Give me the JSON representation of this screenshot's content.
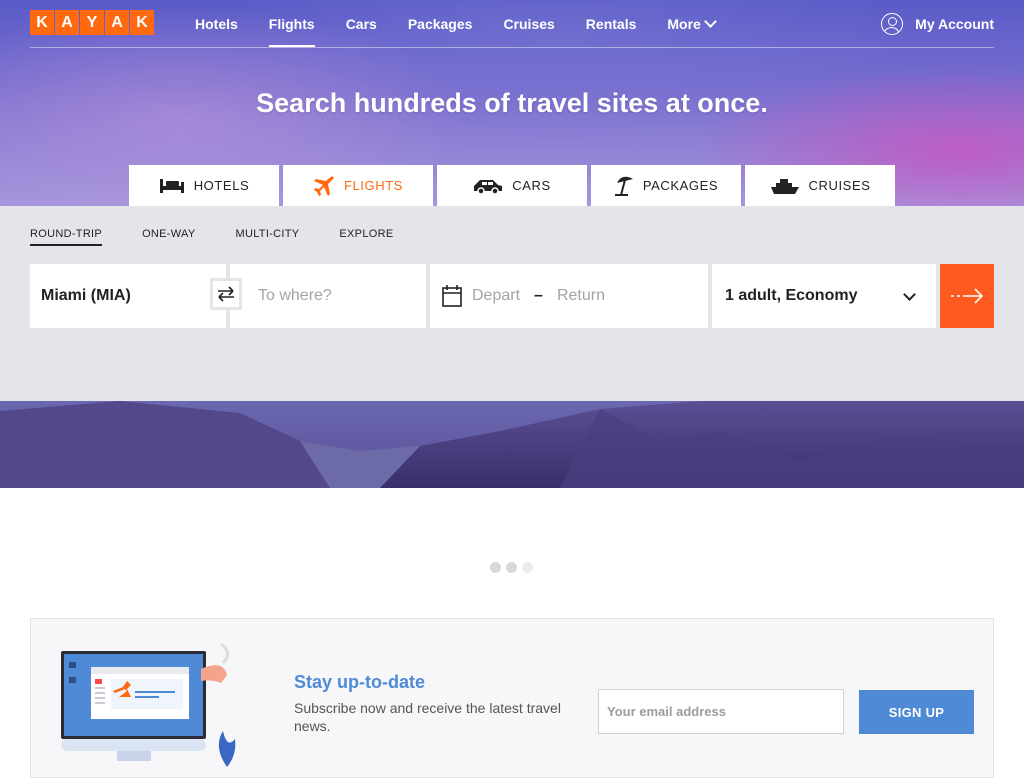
{
  "brand": {
    "logo_letters": [
      "K",
      "A",
      "Y",
      "A",
      "K"
    ],
    "accent": "#ff690f",
    "go_color": "#ff5a1f",
    "link_blue": "#4e8ad6"
  },
  "nav": {
    "links": [
      {
        "label": "Hotels",
        "active": false
      },
      {
        "label": "Flights",
        "active": true
      },
      {
        "label": "Cars",
        "active": false
      },
      {
        "label": "Packages",
        "active": false
      },
      {
        "label": "Cruises",
        "active": false
      },
      {
        "label": "Rentals",
        "active": false
      }
    ],
    "more_label": "More",
    "account_label": "My Account"
  },
  "hero": {
    "headline": "Search hundreds of travel sites at once."
  },
  "verticals": [
    {
      "label": "HOTELS",
      "icon": "bed-icon",
      "active": false
    },
    {
      "label": "FLIGHTS",
      "icon": "airplane-icon",
      "active": true
    },
    {
      "label": "CARS",
      "icon": "car-icon",
      "active": false
    },
    {
      "label": "PACKAGES",
      "icon": "beach-umbrella-icon",
      "active": false
    },
    {
      "label": "CRUISES",
      "icon": "ship-icon",
      "active": false
    }
  ],
  "search": {
    "trip_types": [
      {
        "label": "ROUND-TRIP",
        "active": true
      },
      {
        "label": "ONE-WAY",
        "active": false
      },
      {
        "label": "MULTI-CITY",
        "active": false
      },
      {
        "label": "EXPLORE",
        "active": false
      }
    ],
    "origin": "Miami (MIA)",
    "destination_placeholder": "To where?",
    "depart_placeholder": "Depart",
    "date_separator": "–",
    "return_placeholder": "Return",
    "travelers": "1 adult, Economy"
  },
  "carousel": {
    "dot_count": 3
  },
  "newsletter": {
    "title": "Stay up-to-date",
    "text": "Subscribe now and receive the latest travel news.",
    "email_placeholder": "Your email address",
    "button_label": "SIGN UP"
  }
}
